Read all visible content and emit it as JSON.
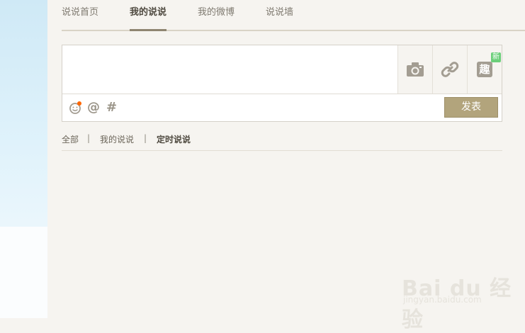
{
  "tabs": [
    {
      "label": "说说首页",
      "active": false
    },
    {
      "label": "我的说说",
      "active": true
    },
    {
      "label": "我的微博",
      "active": false
    },
    {
      "label": "说说墙",
      "active": false
    }
  ],
  "composer": {
    "placeholder": "",
    "media_buttons": [
      {
        "icon": "camera-icon"
      },
      {
        "icon": "link-icon"
      },
      {
        "icon": "qu-icon",
        "glyph": "趣",
        "badge": "新"
      }
    ],
    "tools": [
      {
        "icon": "emoji-icon"
      },
      {
        "icon": "at-icon",
        "glyph": "@"
      },
      {
        "icon": "hashtag-icon",
        "glyph": "#"
      }
    ],
    "publish_label": "发表"
  },
  "filters": {
    "items": [
      "全部",
      "我的说说",
      "定时说说"
    ],
    "separator": "|",
    "active": "定时说说"
  },
  "watermark": {
    "text": "Bai du 经验",
    "sub": "jingyan.baidu.com"
  },
  "colors": {
    "accent": "#b2a47c",
    "badge": "#6ccf7a",
    "notification_dot": "#ff6600"
  }
}
